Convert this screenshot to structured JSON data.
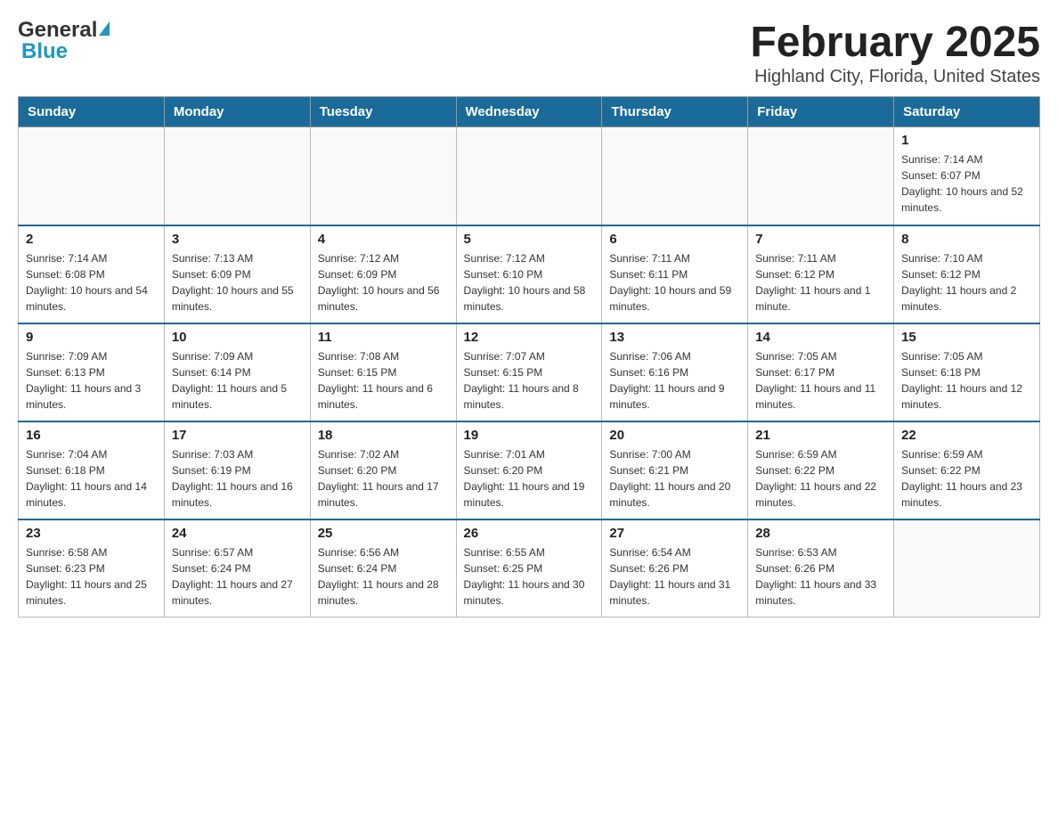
{
  "logo": {
    "general": "General",
    "blue": "Blue"
  },
  "title": "February 2025",
  "subtitle": "Highland City, Florida, United States",
  "headers": [
    "Sunday",
    "Monday",
    "Tuesday",
    "Wednesday",
    "Thursday",
    "Friday",
    "Saturday"
  ],
  "weeks": [
    [
      {
        "day": "",
        "sunrise": "",
        "sunset": "",
        "daylight": ""
      },
      {
        "day": "",
        "sunrise": "",
        "sunset": "",
        "daylight": ""
      },
      {
        "day": "",
        "sunrise": "",
        "sunset": "",
        "daylight": ""
      },
      {
        "day": "",
        "sunrise": "",
        "sunset": "",
        "daylight": ""
      },
      {
        "day": "",
        "sunrise": "",
        "sunset": "",
        "daylight": ""
      },
      {
        "day": "",
        "sunrise": "",
        "sunset": "",
        "daylight": ""
      },
      {
        "day": "1",
        "sunrise": "Sunrise: 7:14 AM",
        "sunset": "Sunset: 6:07 PM",
        "daylight": "Daylight: 10 hours and 52 minutes."
      }
    ],
    [
      {
        "day": "2",
        "sunrise": "Sunrise: 7:14 AM",
        "sunset": "Sunset: 6:08 PM",
        "daylight": "Daylight: 10 hours and 54 minutes."
      },
      {
        "day": "3",
        "sunrise": "Sunrise: 7:13 AM",
        "sunset": "Sunset: 6:09 PM",
        "daylight": "Daylight: 10 hours and 55 minutes."
      },
      {
        "day": "4",
        "sunrise": "Sunrise: 7:12 AM",
        "sunset": "Sunset: 6:09 PM",
        "daylight": "Daylight: 10 hours and 56 minutes."
      },
      {
        "day": "5",
        "sunrise": "Sunrise: 7:12 AM",
        "sunset": "Sunset: 6:10 PM",
        "daylight": "Daylight: 10 hours and 58 minutes."
      },
      {
        "day": "6",
        "sunrise": "Sunrise: 7:11 AM",
        "sunset": "Sunset: 6:11 PM",
        "daylight": "Daylight: 10 hours and 59 minutes."
      },
      {
        "day": "7",
        "sunrise": "Sunrise: 7:11 AM",
        "sunset": "Sunset: 6:12 PM",
        "daylight": "Daylight: 11 hours and 1 minute."
      },
      {
        "day": "8",
        "sunrise": "Sunrise: 7:10 AM",
        "sunset": "Sunset: 6:12 PM",
        "daylight": "Daylight: 11 hours and 2 minutes."
      }
    ],
    [
      {
        "day": "9",
        "sunrise": "Sunrise: 7:09 AM",
        "sunset": "Sunset: 6:13 PM",
        "daylight": "Daylight: 11 hours and 3 minutes."
      },
      {
        "day": "10",
        "sunrise": "Sunrise: 7:09 AM",
        "sunset": "Sunset: 6:14 PM",
        "daylight": "Daylight: 11 hours and 5 minutes."
      },
      {
        "day": "11",
        "sunrise": "Sunrise: 7:08 AM",
        "sunset": "Sunset: 6:15 PM",
        "daylight": "Daylight: 11 hours and 6 minutes."
      },
      {
        "day": "12",
        "sunrise": "Sunrise: 7:07 AM",
        "sunset": "Sunset: 6:15 PM",
        "daylight": "Daylight: 11 hours and 8 minutes."
      },
      {
        "day": "13",
        "sunrise": "Sunrise: 7:06 AM",
        "sunset": "Sunset: 6:16 PM",
        "daylight": "Daylight: 11 hours and 9 minutes."
      },
      {
        "day": "14",
        "sunrise": "Sunrise: 7:05 AM",
        "sunset": "Sunset: 6:17 PM",
        "daylight": "Daylight: 11 hours and 11 minutes."
      },
      {
        "day": "15",
        "sunrise": "Sunrise: 7:05 AM",
        "sunset": "Sunset: 6:18 PM",
        "daylight": "Daylight: 11 hours and 12 minutes."
      }
    ],
    [
      {
        "day": "16",
        "sunrise": "Sunrise: 7:04 AM",
        "sunset": "Sunset: 6:18 PM",
        "daylight": "Daylight: 11 hours and 14 minutes."
      },
      {
        "day": "17",
        "sunrise": "Sunrise: 7:03 AM",
        "sunset": "Sunset: 6:19 PM",
        "daylight": "Daylight: 11 hours and 16 minutes."
      },
      {
        "day": "18",
        "sunrise": "Sunrise: 7:02 AM",
        "sunset": "Sunset: 6:20 PM",
        "daylight": "Daylight: 11 hours and 17 minutes."
      },
      {
        "day": "19",
        "sunrise": "Sunrise: 7:01 AM",
        "sunset": "Sunset: 6:20 PM",
        "daylight": "Daylight: 11 hours and 19 minutes."
      },
      {
        "day": "20",
        "sunrise": "Sunrise: 7:00 AM",
        "sunset": "Sunset: 6:21 PM",
        "daylight": "Daylight: 11 hours and 20 minutes."
      },
      {
        "day": "21",
        "sunrise": "Sunrise: 6:59 AM",
        "sunset": "Sunset: 6:22 PM",
        "daylight": "Daylight: 11 hours and 22 minutes."
      },
      {
        "day": "22",
        "sunrise": "Sunrise: 6:59 AM",
        "sunset": "Sunset: 6:22 PM",
        "daylight": "Daylight: 11 hours and 23 minutes."
      }
    ],
    [
      {
        "day": "23",
        "sunrise": "Sunrise: 6:58 AM",
        "sunset": "Sunset: 6:23 PM",
        "daylight": "Daylight: 11 hours and 25 minutes."
      },
      {
        "day": "24",
        "sunrise": "Sunrise: 6:57 AM",
        "sunset": "Sunset: 6:24 PM",
        "daylight": "Daylight: 11 hours and 27 minutes."
      },
      {
        "day": "25",
        "sunrise": "Sunrise: 6:56 AM",
        "sunset": "Sunset: 6:24 PM",
        "daylight": "Daylight: 11 hours and 28 minutes."
      },
      {
        "day": "26",
        "sunrise": "Sunrise: 6:55 AM",
        "sunset": "Sunset: 6:25 PM",
        "daylight": "Daylight: 11 hours and 30 minutes."
      },
      {
        "day": "27",
        "sunrise": "Sunrise: 6:54 AM",
        "sunset": "Sunset: 6:26 PM",
        "daylight": "Daylight: 11 hours and 31 minutes."
      },
      {
        "day": "28",
        "sunrise": "Sunrise: 6:53 AM",
        "sunset": "Sunset: 6:26 PM",
        "daylight": "Daylight: 11 hours and 33 minutes."
      },
      {
        "day": "",
        "sunrise": "",
        "sunset": "",
        "daylight": ""
      }
    ]
  ]
}
